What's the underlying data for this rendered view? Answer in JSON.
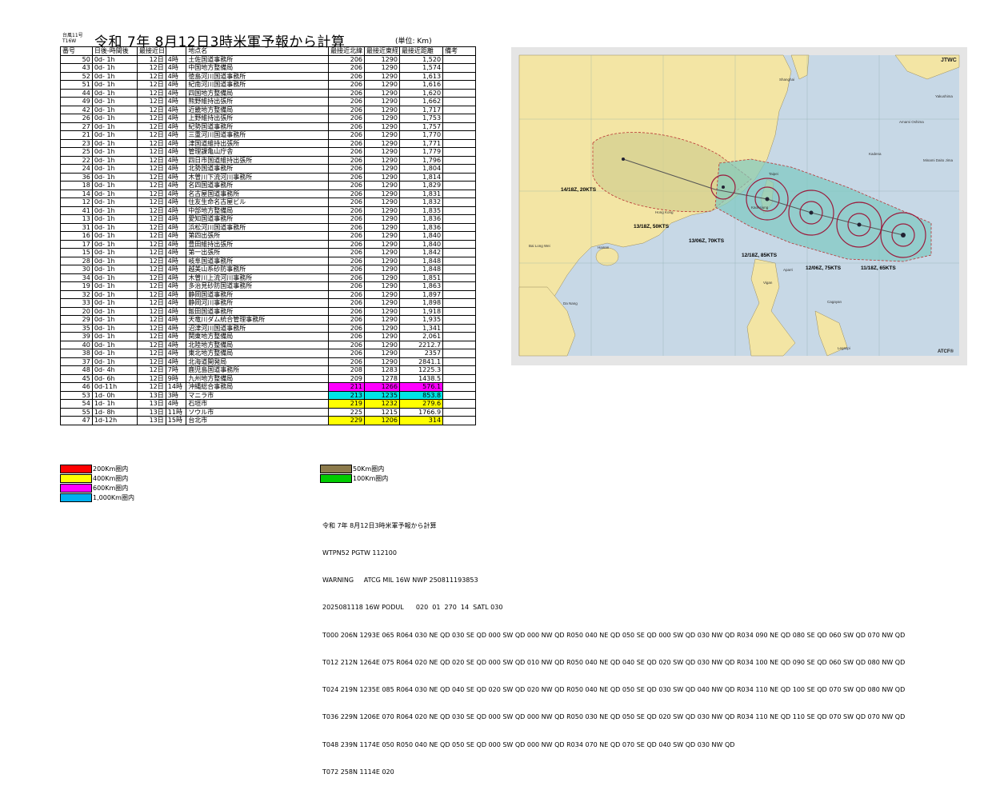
{
  "header": {
    "typhoon_label_1": "台風11号",
    "typhoon_label_2": "T16W",
    "title": "令和 7年 8月12日3時米軍予報から計算",
    "unit": "(単位: Km)"
  },
  "table": {
    "headers": [
      "番号",
      "日後-時間後",
      "最接近日",
      "",
      "地点名",
      "最接近北緯",
      "最接近東経",
      "最接近距離",
      "備考"
    ],
    "rows": [
      [
        "50",
        "0d- 1h",
        "12日",
        "4時",
        "土佐国道事務所",
        "206",
        "1290",
        "1,520",
        ""
      ],
      [
        "43",
        "0d- 1h",
        "12日",
        "4時",
        "中国地方整備局",
        "206",
        "1290",
        "1,574",
        ""
      ],
      [
        "52",
        "0d- 1h",
        "12日",
        "4時",
        "徳島河川国道事務所",
        "206",
        "1290",
        "1,613",
        ""
      ],
      [
        "51",
        "0d- 1h",
        "12日",
        "4時",
        "紀南河川国道事務所",
        "206",
        "1290",
        "1,616",
        ""
      ],
      [
        "44",
        "0d- 1h",
        "12日",
        "4時",
        "四国地方整備局",
        "206",
        "1290",
        "1,620",
        ""
      ],
      [
        "49",
        "0d- 1h",
        "12日",
        "4時",
        "熊野維持出張所",
        "206",
        "1290",
        "1,662",
        ""
      ],
      [
        "42",
        "0d- 1h",
        "12日",
        "4時",
        "近畿地方整備局",
        "206",
        "1290",
        "1,717",
        ""
      ],
      [
        "26",
        "0d- 1h",
        "12日",
        "4時",
        "上野維持出張所",
        "206",
        "1290",
        "1,753",
        ""
      ],
      [
        "27",
        "0d- 1h",
        "12日",
        "4時",
        "紀勢国道事務所",
        "206",
        "1290",
        "1,757",
        ""
      ],
      [
        "21",
        "0d- 1h",
        "12日",
        "4時",
        "三重河川国道事務所",
        "206",
        "1290",
        "1,770",
        ""
      ],
      [
        "23",
        "0d- 1h",
        "12日",
        "4時",
        "津国道維持出張所",
        "206",
        "1290",
        "1,771",
        ""
      ],
      [
        "25",
        "0d- 1h",
        "12日",
        "4時",
        "管理課亀山庁舎",
        "206",
        "1290",
        "1,779",
        ""
      ],
      [
        "22",
        "0d- 1h",
        "12日",
        "4時",
        "四日市国道維持出張所",
        "206",
        "1290",
        "1,796",
        ""
      ],
      [
        "24",
        "0d- 1h",
        "12日",
        "4時",
        "北勢国道事務所",
        "206",
        "1290",
        "1,804",
        ""
      ],
      [
        "36",
        "0d- 1h",
        "12日",
        "4時",
        "木曽川下流河川事務所",
        "206",
        "1290",
        "1,814",
        ""
      ],
      [
        "18",
        "0d- 1h",
        "12日",
        "4時",
        "名四国道事務所",
        "206",
        "1290",
        "1,829",
        ""
      ],
      [
        "14",
        "0d- 1h",
        "12日",
        "4時",
        "名古屋国道事務所",
        "206",
        "1290",
        "1,831",
        ""
      ],
      [
        "12",
        "0d- 1h",
        "12日",
        "4時",
        "住友生命名古屋ビル",
        "206",
        "1290",
        "1,832",
        ""
      ],
      [
        "41",
        "0d- 1h",
        "12日",
        "4時",
        "中部地方整備局",
        "206",
        "1290",
        "1,835",
        ""
      ],
      [
        "13",
        "0d- 1h",
        "12日",
        "4時",
        "愛知国道事務所",
        "206",
        "1290",
        "1,836",
        ""
      ],
      [
        "31",
        "0d- 1h",
        "12日",
        "4時",
        "浜松河川国道事務所",
        "206",
        "1290",
        "1,836",
        ""
      ],
      [
        "16",
        "0d- 1h",
        "12日",
        "4時",
        "第四出張所",
        "206",
        "1290",
        "1,840",
        ""
      ],
      [
        "17",
        "0d- 1h",
        "12日",
        "4時",
        "豊田維持出張所",
        "206",
        "1290",
        "1,840",
        ""
      ],
      [
        "15",
        "0d- 1h",
        "12日",
        "4時",
        "第一出張所",
        "206",
        "1290",
        "1,842",
        ""
      ],
      [
        "28",
        "0d- 1h",
        "12日",
        "4時",
        "岐阜国道事務所",
        "206",
        "1290",
        "1,848",
        ""
      ],
      [
        "30",
        "0d- 1h",
        "12日",
        "4時",
        "越美山系砂防事務所",
        "206",
        "1290",
        "1,848",
        ""
      ],
      [
        "34",
        "0d- 1h",
        "12日",
        "4時",
        "木曽川上流河川事務所",
        "206",
        "1290",
        "1,851",
        ""
      ],
      [
        "19",
        "0d- 1h",
        "12日",
        "4時",
        "多治見砂防国道事務所",
        "206",
        "1290",
        "1,863",
        ""
      ],
      [
        "32",
        "0d- 1h",
        "12日",
        "4時",
        "静岡国道事務所",
        "206",
        "1290",
        "1,897",
        ""
      ],
      [
        "33",
        "0d- 1h",
        "12日",
        "4時",
        "静岡河川事務所",
        "206",
        "1290",
        "1,898",
        ""
      ],
      [
        "20",
        "0d- 1h",
        "12日",
        "4時",
        "飯田国道事務所",
        "206",
        "1290",
        "1,918",
        ""
      ],
      [
        "29",
        "0d- 1h",
        "12日",
        "4時",
        "天竜川ダム統合管理事務所",
        "206",
        "1290",
        "1,935",
        ""
      ],
      [
        "35",
        "0d- 1h",
        "12日",
        "4時",
        "沼津河川国道事務所",
        "206",
        "1290",
        "1,341",
        ""
      ],
      [
        "39",
        "0d- 1h",
        "12日",
        "4時",
        "関東地方整備局",
        "206",
        "1290",
        "2,061",
        ""
      ],
      [
        "40",
        "0d- 1h",
        "12日",
        "4時",
        "北陸地方整備局",
        "206",
        "1290",
        "2212.7",
        ""
      ],
      [
        "38",
        "0d- 1h",
        "12日",
        "4時",
        "東北地方整備局",
        "206",
        "1290",
        "2357",
        ""
      ],
      [
        "37",
        "0d- 1h",
        "12日",
        "4時",
        "北海道開発局",
        "206",
        "1290",
        "2841.1",
        ""
      ],
      [
        "48",
        "0d- 4h",
        "12日",
        "7時",
        "鹿児島国道事務所",
        "208",
        "1283",
        "1225.3",
        ""
      ],
      [
        "45",
        "0d- 6h",
        "12日",
        "9時",
        "九州地方整備局",
        "209",
        "1278",
        "1438.5",
        ""
      ],
      [
        "46",
        "0d-11h",
        "12日",
        "14時",
        "沖縄総合事務局",
        "211",
        "1266",
        "576.1",
        ""
      ],
      [
        "53",
        "1d- 0h",
        "13日",
        "3時",
        "マニラ市",
        "213",
        "1235",
        "853.8",
        ""
      ],
      [
        "54",
        "1d- 1h",
        "13日",
        "4時",
        "石垣市",
        "219",
        "1232",
        "279.6",
        ""
      ],
      [
        "55",
        "1d- 8h",
        "13日",
        "11時",
        "ソウル市",
        "225",
        "1215",
        "1766.9",
        ""
      ],
      [
        "47",
        "1d-12h",
        "13日",
        "15時",
        "台北市",
        "229",
        "1206",
        "314",
        ""
      ]
    ],
    "row_highlight": {
      "39": "#ff00ff",
      "40": "#00e5e5",
      "41": "#ffff00",
      "43": "#ffff00"
    }
  },
  "legend_left": [
    {
      "label": "200Km圏内",
      "color": "#ff0000"
    },
    {
      "label": "400Km圏内",
      "color": "#ffff00"
    },
    {
      "label": "600Km圏内",
      "color": "#ff00ff"
    },
    {
      "label": "1,000Km圏内",
      "color": "#00b0f0"
    }
  ],
  "legend_right": [
    {
      "label": "50Km圏内",
      "color": "#8c7a4b"
    },
    {
      "label": "100Km圏内",
      "color": "#00cc00"
    }
  ],
  "map": {
    "agency": "JTWC",
    "credit": "ATCF®",
    "track_labels": [
      "14/18Z, 20KTS",
      "13/18Z, 50KTS",
      "13/06Z, 70KTS",
      "12/18Z, 85KTS",
      "12/06Z, 75KTS",
      "11/18Z, 65KTS"
    ],
    "places": [
      "Shanghai",
      "Yakushima",
      "Amami Oshima",
      "Kadena",
      "Minami Daito Jima",
      "Taipei",
      "Kaohsiung",
      "Hong Kong",
      "Hainan",
      "Bai Long Wei",
      "Da Nang",
      "Aparri",
      "Vigan",
      "Cagayan",
      "Legaspi"
    ],
    "colors": {
      "sea": "#c7d8e6",
      "land": "#f3e5a4",
      "cone": "#7ec9c1",
      "cone_old": "#d6d191",
      "track": "#9b1b3c"
    }
  },
  "bulletin": {
    "lines": [
      "令和 7年 8月12日3時米軍予報から計算",
      "WTPN52 PGTW 112100",
      "WARNING     ATCG MIL 16W NWP 250811193853",
      "2025081118 16W PODUL      020  01  270  14  SATL 030",
      "T000 206N 1293E 065 R064 030 NE QD 030 SE QD 000 SW QD 000 NW QD R050 040 NE QD 050 SE QD 000 SW QD 030 NW QD R034 090 NE QD 080 SE QD 060 SW QD 070 NW QD",
      "T012 212N 1264E 075 R064 020 NE QD 020 SE QD 000 SW QD 010 NW QD R050 040 NE QD 040 SE QD 020 SW QD 030 NW QD R034 100 NE QD 090 SE QD 060 SW QD 080 NW QD",
      "T024 219N 1235E 085 R064 030 NE QD 040 SE QD 020 SW QD 020 NW QD R050 040 NE QD 050 SE QD 030 SW QD 040 NW QD R034 110 NE QD 100 SE QD 070 SW QD 080 NW QD",
      "T036 229N 1206E 070 R064 020 NE QD 030 SE QD 000 SW QD 000 NW QD R050 030 NE QD 050 SE QD 020 SW QD 030 NW QD R034 110 NE QD 110 SE QD 070 SW QD 070 NW QD",
      "T048 239N 1174E 050 R050 040 NE QD 050 SE QD 000 SW QD 000 NW QD R034 070 NE QD 070 SE QD 040 SW QD 030 NW QD",
      "T072 258N 1114E 020"
    ]
  }
}
